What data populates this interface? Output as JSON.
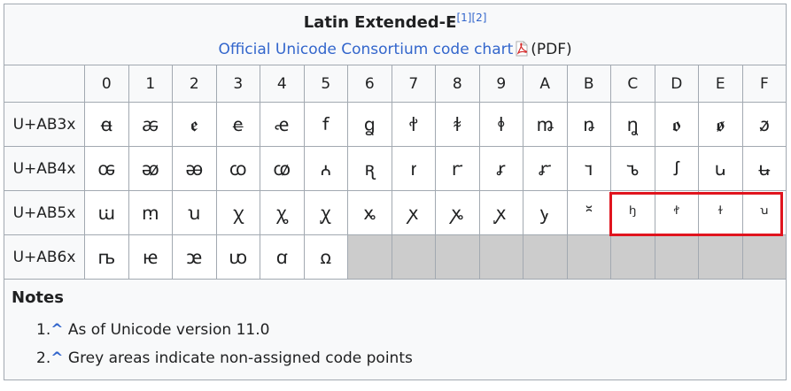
{
  "title": "Latin Extended-E",
  "refs": [
    "[1]",
    "[2]"
  ],
  "subtitle_link": "Official Unicode Consortium code chart",
  "subtitle_suffix": "(PDF)",
  "columns": [
    "",
    "0",
    "1",
    "2",
    "3",
    "4",
    "5",
    "6",
    "7",
    "8",
    "9",
    "A",
    "B",
    "C",
    "D",
    "E",
    "F"
  ],
  "rows": [
    {
      "label": "U+AB3x",
      "cells": [
        "ꬰ",
        "ꬱ",
        "ꬲ",
        "ꬳ",
        "ꬴ",
        "ꬵ",
        "ꬶ",
        "ꬷ",
        "ꬸ",
        "ꬹ",
        "ꬺ",
        "ꬻ",
        "ꬼ",
        "ꬽ",
        "ꬾ",
        "ꬿ"
      ]
    },
    {
      "label": "U+AB4x",
      "cells": [
        "ꭀ",
        "ꭁ",
        "ꭂ",
        "ꭃ",
        "ꭄ",
        "ꭅ",
        "ꭆ",
        "ꭇ",
        "ꭈ",
        "ꭉ",
        "ꭊ",
        "ꭋ",
        "ꭌ",
        "ꭍ",
        "ꭎ",
        "ꭏ"
      ]
    },
    {
      "label": "U+AB5x",
      "cells": [
        "ꭐ",
        "ꭑ",
        "ꭒ",
        "ꭓ",
        "ꭔ",
        "ꭕ",
        "ꭖ",
        "ꭗ",
        "ꭘ",
        "ꭙ",
        "ꭚ",
        "꭛",
        "ꭜ",
        "ꭝ",
        "ꭞ",
        "ꭟ"
      ]
    },
    {
      "label": "U+AB6x",
      "cells": [
        "ꭠ",
        "ꭡ",
        "ꭢ",
        "ꭣ",
        "ꭤ",
        "ꭥ",
        "",
        "",
        "",
        "",
        "",
        "",
        "",
        "",
        "",
        ""
      ]
    }
  ],
  "notes": {
    "heading": "Notes",
    "items": [
      {
        "marker": "1.",
        "caret": "^",
        "text": "As of Unicode version 11.0"
      },
      {
        "marker": "2.",
        "caret": "^",
        "text": "Grey areas indicate non-assigned code points"
      }
    ]
  },
  "colors": {
    "link": "#3366cc",
    "grey": "#cccccc",
    "highlight": "#e0141e"
  }
}
